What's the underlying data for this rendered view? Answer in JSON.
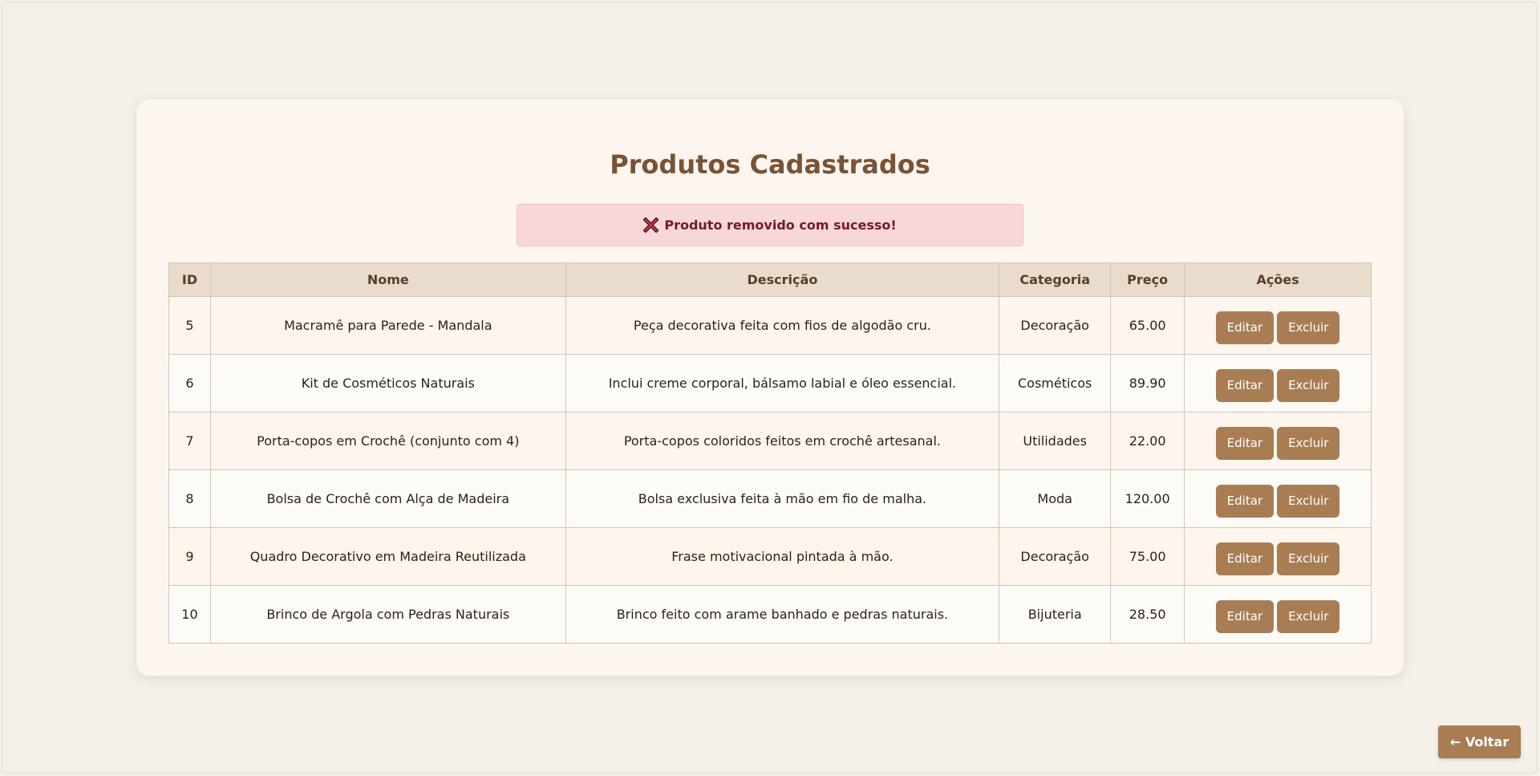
{
  "page": {
    "title": "Produtos Cadastrados",
    "alert": {
      "icon": "close-x-icon",
      "text": "Produto removido com sucesso!"
    },
    "back_label": "← Voltar"
  },
  "table": {
    "headers": [
      "ID",
      "Nome",
      "Descrição",
      "Categoria",
      "Preço",
      "Ações"
    ],
    "rows": [
      {
        "id": "5",
        "nome": "Macramê para Parede - Mandala",
        "descricao": "Peça decorativa feita com fios de algodão cru.",
        "categoria": "Decoração",
        "preco": "65.00"
      },
      {
        "id": "6",
        "nome": "Kit de Cosméticos Naturais",
        "descricao": "Inclui creme corporal, bálsamo labial e óleo essencial.",
        "categoria": "Cosméticos",
        "preco": "89.90"
      },
      {
        "id": "7",
        "nome": "Porta-copos em Crochê (conjunto com 4)",
        "descricao": "Porta-copos coloridos feitos em crochê artesanal.",
        "categoria": "Utilidades",
        "preco": "22.00"
      },
      {
        "id": "8",
        "nome": "Bolsa de Crochê com Alça de Madeira",
        "descricao": "Bolsa exclusiva feita à mão em fio de malha.",
        "categoria": "Moda",
        "preco": "120.00"
      },
      {
        "id": "9",
        "nome": "Quadro Decorativo em Madeira Reutilizada",
        "descricao": "Frase motivacional pintada à mão.",
        "categoria": "Decoração",
        "preco": "75.00"
      },
      {
        "id": "10",
        "nome": "Brinco de Argola com Pedras Naturais",
        "descricao": "Brinco feito com arame banhado e pedras naturais.",
        "categoria": "Bijuteria",
        "preco": "28.50"
      }
    ],
    "actions": {
      "edit_label": "Editar",
      "delete_label": "Excluir"
    }
  },
  "colors": {
    "accent": "#a87d54",
    "title": "#7a5234",
    "alert_bg": "#f8d7da",
    "alert_text": "#721c24",
    "header_bg": "#e9dccc"
  }
}
